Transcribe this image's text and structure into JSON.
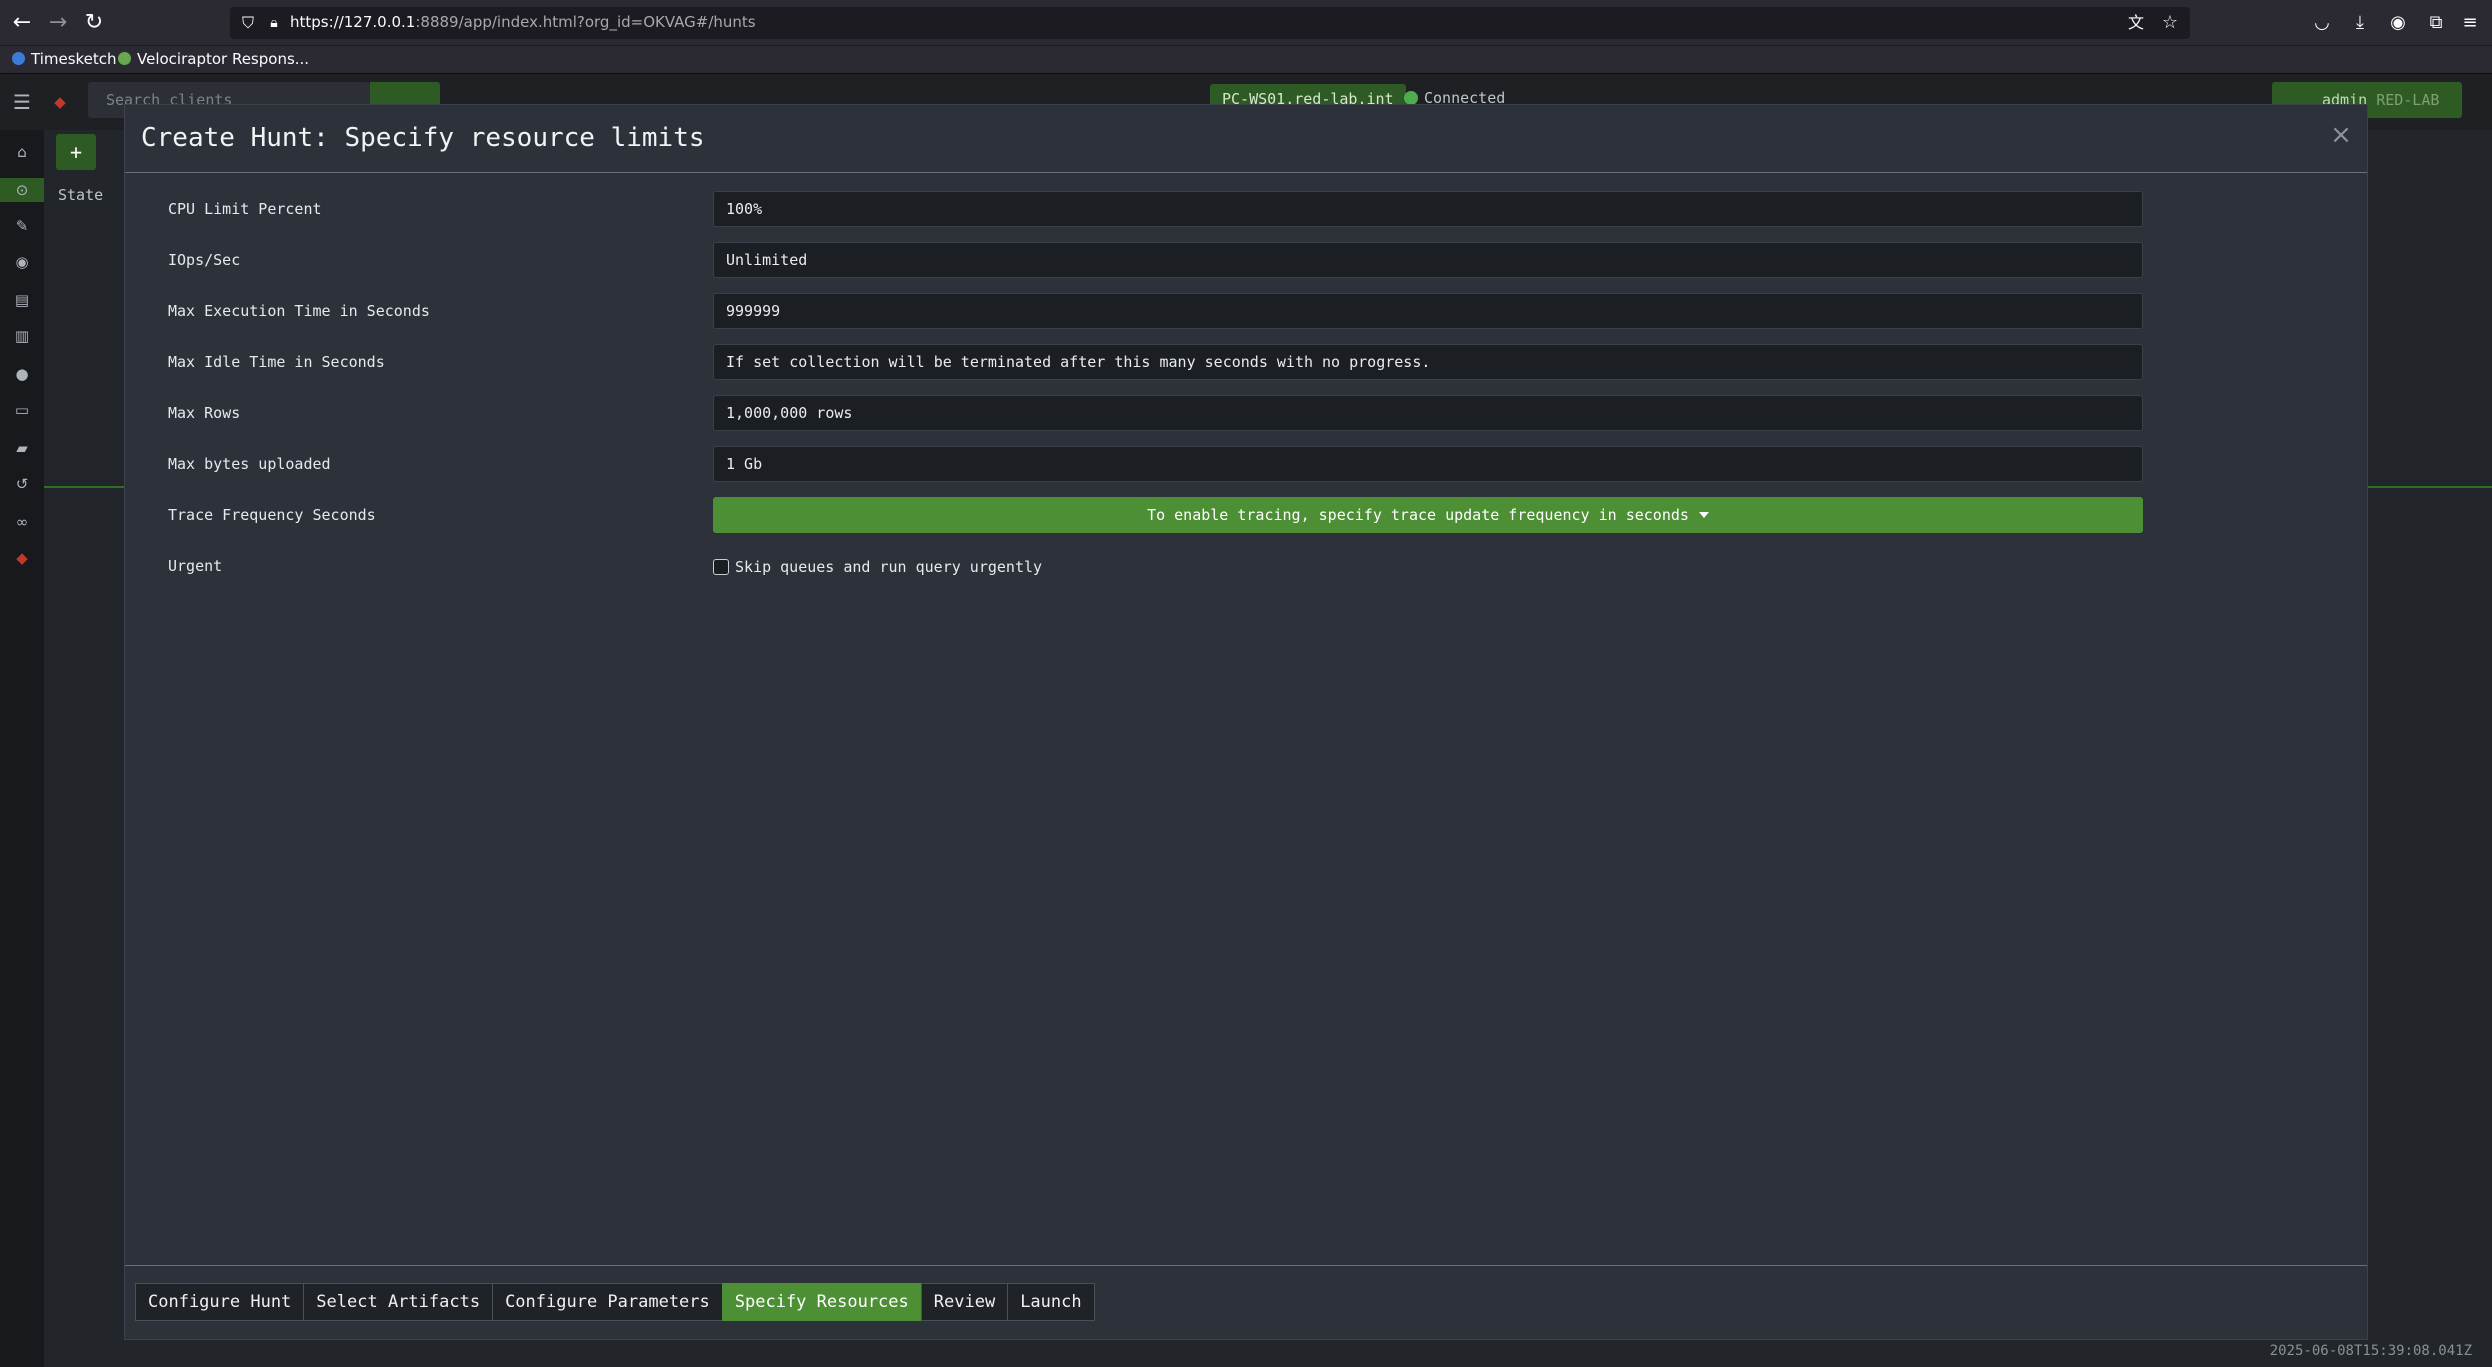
{
  "browser": {
    "url_host": "https://127.0.0.1",
    "url_rest": ":8889/app/index.html?org_id=OKVAG#/hunts",
    "bookmarks": [
      "Timesketch",
      "Velociraptor Respons..."
    ]
  },
  "app": {
    "search_placeholder": "Search clients",
    "host": "PC-WS01.red-lab.int",
    "connection_status": "Connected",
    "user": "admin",
    "org": "RED-LAB",
    "table_header_state": "State",
    "timestamp": "2025-06-08T15:39:08.041Z"
  },
  "modal": {
    "title": "Create Hunt: Specify resource limits",
    "close_icon": "×",
    "fields": {
      "cpu": {
        "label": "CPU Limit Percent",
        "placeholder": "100%"
      },
      "iops": {
        "label": "IOps/Sec",
        "placeholder": "Unlimited"
      },
      "max_exec": {
        "label": "Max Execution Time in Seconds",
        "placeholder": "999999"
      },
      "max_idle": {
        "label": "Max Idle Time in Seconds",
        "placeholder": "If set collection will be terminated after this many seconds with no progress."
      },
      "max_rows": {
        "label": "Max Rows",
        "placeholder": "1,000,000 rows"
      },
      "max_bytes": {
        "label": "Max bytes uploaded",
        "placeholder": "1 Gb"
      },
      "trace": {
        "label": "Trace Frequency Seconds",
        "button": "To enable tracing, specify trace update frequency in seconds"
      },
      "urgent": {
        "label": "Urgent",
        "checkbox_label": "Skip queues and run query urgently",
        "checked": false
      }
    },
    "steps": [
      "Configure Hunt",
      "Select Artifacts",
      "Configure Parameters",
      "Specify Resources",
      "Review",
      "Launch"
    ],
    "active_step": "Specify Resources"
  },
  "colors": {
    "accent_green": "#4d8f35",
    "modal_bg": "#2d323a",
    "input_bg": "#1b1f24"
  }
}
